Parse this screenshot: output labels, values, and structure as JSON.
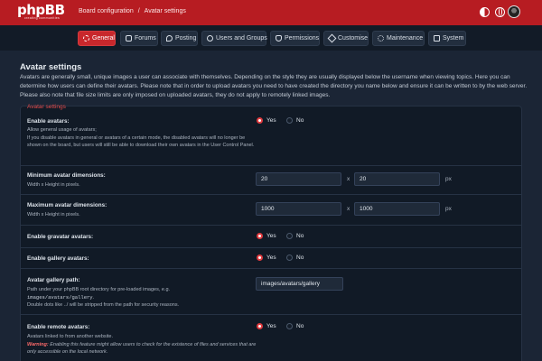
{
  "header": {
    "logo": "phpBB",
    "logo_sub": "creating communities",
    "breadcrumb": [
      "Board configuration",
      "Avatar settings"
    ],
    "breadcrumb_sep": "/"
  },
  "nav": {
    "tabs": [
      {
        "label": "General",
        "icon": "gear-icon",
        "active": true
      },
      {
        "label": "Forums",
        "icon": "chat-icon",
        "active": false
      },
      {
        "label": "Posting",
        "icon": "bubble-icon",
        "active": false
      },
      {
        "label": "Users and Groups",
        "icon": "users-icon",
        "active": false
      },
      {
        "label": "Permissions",
        "icon": "shield-icon",
        "active": false
      },
      {
        "label": "Customise",
        "icon": "brush-icon",
        "active": false
      },
      {
        "label": "Maintenance",
        "icon": "cog-icon",
        "active": false
      },
      {
        "label": "System",
        "icon": "monitor-icon",
        "active": false
      }
    ]
  },
  "page": {
    "title": "Avatar settings",
    "description": "Avatars are generally small, unique images a user can associate with themselves. Depending on the style they are usually displayed below the username when viewing topics. Here you can determine how users can define their avatars. Please note that in order to upload avatars you need to have created the directory you name below and ensure it can be written to by the web server. Please also note that file size limits are only imposed on uploaded avatars, they do not apply to remotely linked images."
  },
  "fieldset": {
    "legend": "Avatar settings",
    "enable_avatars": {
      "label": "Enable avatars:",
      "explain1": "Allow general usage of avatars;",
      "explain2": "If you disable avatars in general or avatars of a certain mode, the disabled avatars will no longer be shown on the board, but users will still be able to download their own avatars in the User Control Panel.",
      "yes": "Yes",
      "no": "No",
      "value": "yes"
    },
    "min_dims": {
      "label": "Minimum avatar dimensions:",
      "explain": "Width x Height in pixels.",
      "width": "20",
      "height": "20",
      "sep": "x",
      "unit": "px"
    },
    "max_dims": {
      "label": "Maximum avatar dimensions:",
      "explain": "Width x Height in pixels.",
      "width": "1000",
      "height": "1000",
      "sep": "x",
      "unit": "px"
    },
    "gravatar": {
      "label": "Enable gravatar avatars:",
      "yes": "Yes",
      "no": "No",
      "value": "yes"
    },
    "gallery": {
      "label": "Enable gallery avatars:",
      "yes": "Yes",
      "no": "No",
      "value": "yes"
    },
    "gallery_path": {
      "label": "Avatar gallery path:",
      "explain1": "Path under your phpBB root directory for pre-loaded images, e.g.",
      "explain_code": "images/avatars/gallery",
      "explain1_end": ".",
      "explain2": "Double dots like ../ will be stripped from the path for security reasons.",
      "value": "images/avatars/gallery"
    },
    "remote": {
      "label": "Enable remote avatars:",
      "explain": "Avatars linked to from another website.",
      "warning_label": "Warning:",
      "warning_text": "Enabling this feature might allow users to check for the existence of files and services that are only accessible on the local network.",
      "yes": "Yes",
      "no": "No",
      "value": "yes"
    }
  },
  "colors": {
    "brand": "#b71c22",
    "accent": "#c8282c",
    "bg": "#1b2535"
  }
}
